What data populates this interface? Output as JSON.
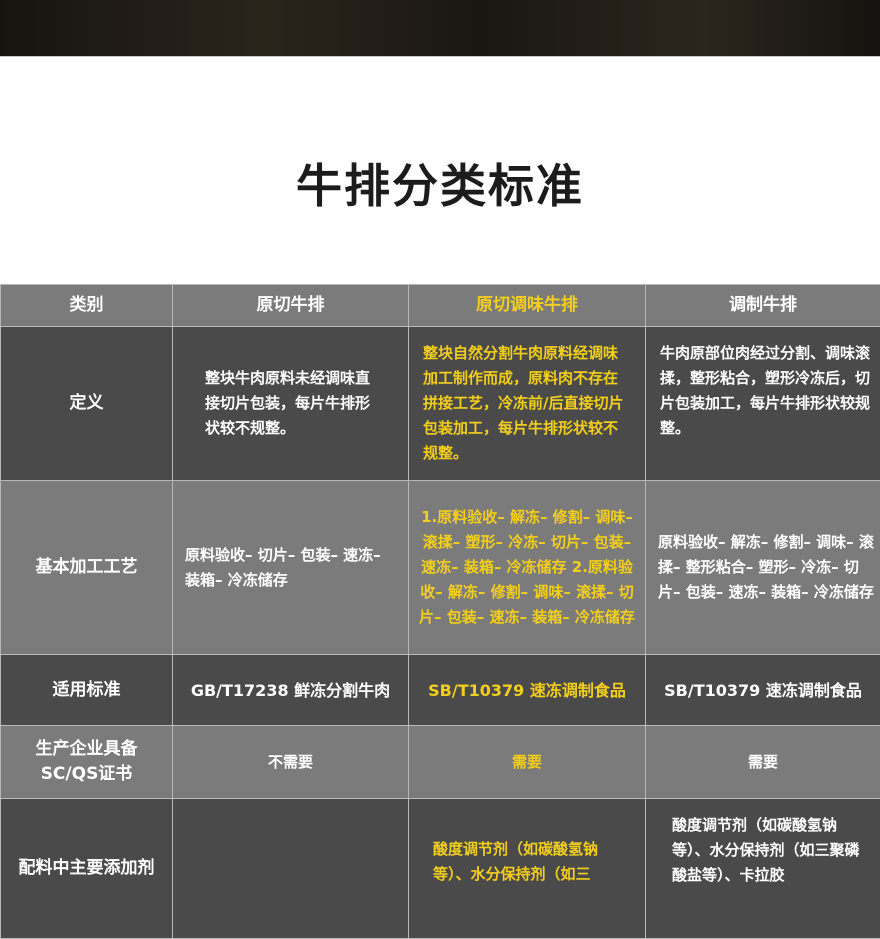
{
  "title": "牛排分类标准",
  "header": [
    "类别",
    "原切牛排",
    "原切调味牛排",
    "调制牛排"
  ],
  "rows": {
    "definition": {
      "label": "定义",
      "c1": "整块牛肉原料未经调味直接切片包装，每片牛排形状较不规整。",
      "c2": "整块自然分割牛肉原料经调味加工制作而成，原料肉不存在拼接工艺，冷冻前/后直接切片包装加工，每片牛排形状较不规整。",
      "c3": "牛肉原部位肉经过分割、调味滚揉，整形粘合，塑形冷冻后，切片包装加工，每片牛排形状较规整。"
    },
    "process": {
      "label": "基本加工工艺",
      "c1": "原料验收– 切片– 包装– 速冻– 装箱– 冷冻储存",
      "c2": "1.原料验收– 解冻– 修割– 调味– 滚揉– 塑形– 冷冻– 切片– 包装– 速冻– 装箱– 冷冻储存 2.原料验收– 解冻– 修割– 调味– 滚揉– 切片– 包装– 速冻– 装箱– 冷冻储存",
      "c3": "原料验收– 解冻– 修割– 调味– 滚揉– 整形粘合– 塑形– 冷冻– 切片– 包装– 速冻– 装箱– 冷冻储存"
    },
    "standard": {
      "label": "适用标准",
      "c1": "GB/T17238  鲜冻分割牛肉",
      "c2": "SB/T10379  速冻调制食品",
      "c3": "SB/T10379  速冻调制食品"
    },
    "license": {
      "label": "生产企业具备SC/QS证书",
      "c1": "不需要",
      "c2": "需要",
      "c3": "需要"
    },
    "additives": {
      "label": "配料中主要添加剂",
      "c1": "",
      "c2": "酸度调节剂（如碳酸氢钠等）、水分保持剂（如三",
      "c3": "酸度调节剂（如碳酸氢钠等）、水分保持剂（如三聚磷酸盐等）、卡拉胶"
    }
  }
}
